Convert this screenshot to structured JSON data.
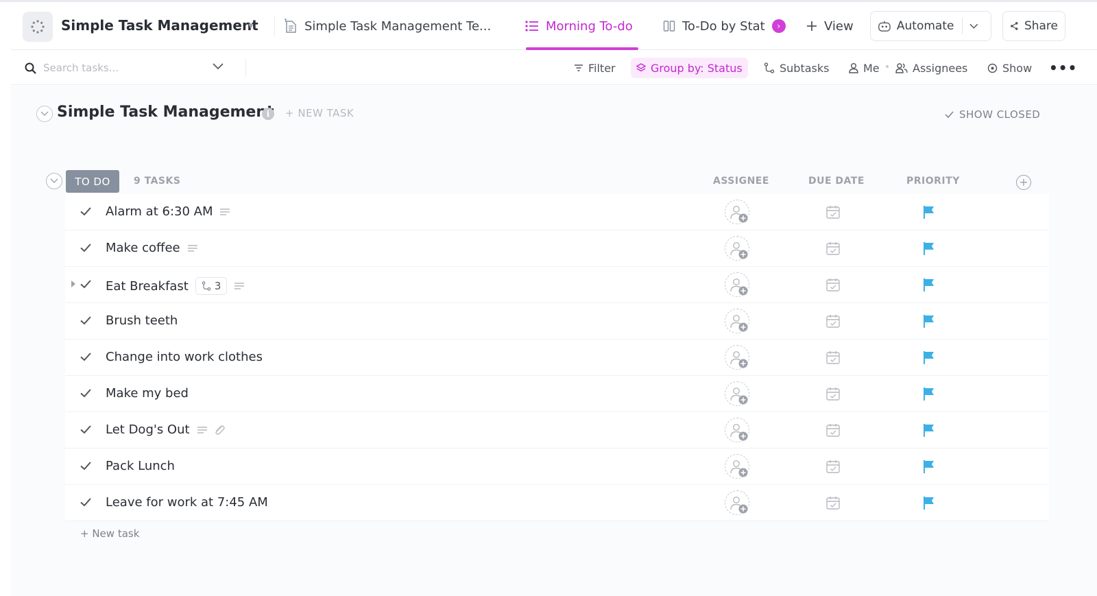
{
  "header": {
    "space_title": "Simple Task Management",
    "tabs": [
      {
        "label": "Simple Task Management Te...",
        "icon": "doc-icon"
      },
      {
        "label": "Morning To-do",
        "icon": "list-icon",
        "active": true
      },
      {
        "label": "To-Do by Stat",
        "icon": "board-icon"
      }
    ],
    "add_view_label": "View",
    "automate_label": "Automate",
    "share_label": "Share"
  },
  "toolbar": {
    "search_placeholder": "Search tasks...",
    "filter_label": "Filter",
    "group_label": "Group by: Status",
    "subtasks_label": "Subtasks",
    "me_label": "Me",
    "assignees_label": "Assignees",
    "show_label": "Show",
    "more_label": "•••"
  },
  "list": {
    "title": "Simple Task Management",
    "new_task_label": "+ NEW TASK",
    "show_closed_label": "SHOW CLOSED",
    "group": {
      "status_label": "TO DO",
      "count_label": "9 TASKS",
      "columns": {
        "assignee": "ASSIGNEE",
        "due_date": "DUE DATE",
        "priority": "PRIORITY"
      },
      "tasks": [
        {
          "name": "Alarm at 6:30 AM"
        },
        {
          "name": "Make coffee"
        },
        {
          "name": "Eat Breakfast",
          "subtask_count": "3"
        },
        {
          "name": "Brush teeth"
        },
        {
          "name": "Change into work clothes"
        },
        {
          "name": "Make my bed"
        },
        {
          "name": "Let Dog's Out"
        },
        {
          "name": "Pack Lunch"
        },
        {
          "name": "Leave for work at 7:45 AM"
        }
      ],
      "new_task_label": "+ New task"
    }
  },
  "colors": {
    "accent": "#d13fd7",
    "status_todo": "#87909e",
    "priority_flag": "#3db0e6"
  }
}
